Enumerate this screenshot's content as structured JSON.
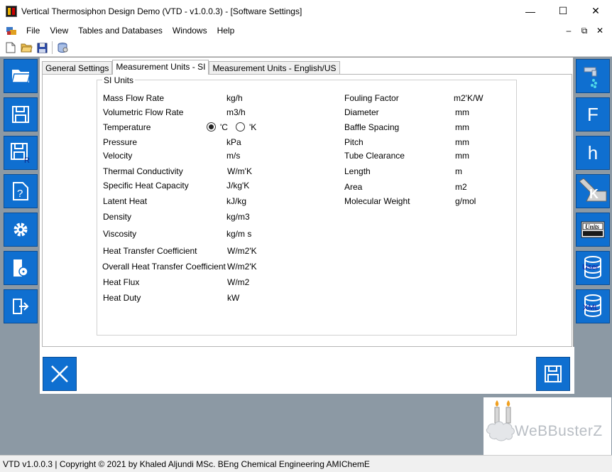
{
  "window": {
    "title": "Vertical Thermosiphon Design Demo (VTD - v1.0.0.3) - [Software Settings]",
    "minimize": "—",
    "maximize": "☐",
    "close": "✕"
  },
  "menu": {
    "items": [
      "File",
      "View",
      "Tables and Databases",
      "Windows",
      "Help"
    ],
    "mdi_minimize": "–",
    "mdi_restore": "⧉",
    "mdi_close": "✕"
  },
  "tabs": [
    {
      "label": "General Settings",
      "active": false
    },
    {
      "label": "Measurement Units - SI",
      "active": true
    },
    {
      "label": "Measurement Units - English/US",
      "active": false
    }
  ],
  "group": {
    "legend": "SI Units",
    "left_rows": [
      {
        "label": "Mass Flow Rate",
        "unit": "kg/h"
      },
      {
        "label": "Volumetric Flow Rate",
        "unit": "m3/h"
      },
      {
        "label": "Temperature",
        "unit": ""
      },
      {
        "label": "Pressure",
        "unit": "kPa"
      },
      {
        "label": "Velocity",
        "unit": "m/s"
      },
      {
        "label": "Thermal Conductivity",
        "unit": "W/m'K"
      },
      {
        "label": "Specific Heat Capacity",
        "unit": "J/kg'K"
      },
      {
        "label": "Latent Heat",
        "unit": "kJ/kg"
      },
      {
        "label": "Density",
        "unit": "kg/m3"
      },
      {
        "label": "Viscosity",
        "unit": "kg/m s"
      },
      {
        "label": "Heat Transfer Coefficient",
        "unit": "W/m2'K"
      },
      {
        "label": "Overall Heat Transfer Coefficient",
        "unit": "W/m2'K"
      },
      {
        "label": "Heat Flux",
        "unit": "W/m2"
      },
      {
        "label": "Heat Duty",
        "unit": "kW"
      }
    ],
    "right_rows": [
      {
        "label": "Fouling Factor",
        "unit": "m2'K/W"
      },
      {
        "label": "Diameter",
        "unit": "mm"
      },
      {
        "label": "Baffle Spacing",
        "unit": "mm"
      },
      {
        "label": "Pitch",
        "unit": "mm"
      },
      {
        "label": "Tube Clearance",
        "unit": "mm"
      },
      {
        "label": "Length",
        "unit": "m"
      },
      {
        "label": "Area",
        "unit": "m2"
      },
      {
        "label": "Molecular Weight",
        "unit": "g/mol"
      }
    ],
    "temperature_options": [
      {
        "label": "'C",
        "selected": true
      },
      {
        "label": "'K",
        "selected": false
      }
    ]
  },
  "right_toolbar": {
    "f_label": "F",
    "h_label": "h",
    "k_label": "K",
    "units_label": "Units",
    "user_label": "User",
    "xml_label": "XML"
  },
  "logo": {
    "text": "WeBBusterZ"
  },
  "status": {
    "text": "VTD v1.0.0.3  |  Copyright © 2021 by Khaled Aljundi MSc. BEng Chemical Engineering AMIChemE"
  },
  "colors": {
    "accent": "#0f6fd0",
    "workspace": "#8c99a4"
  }
}
